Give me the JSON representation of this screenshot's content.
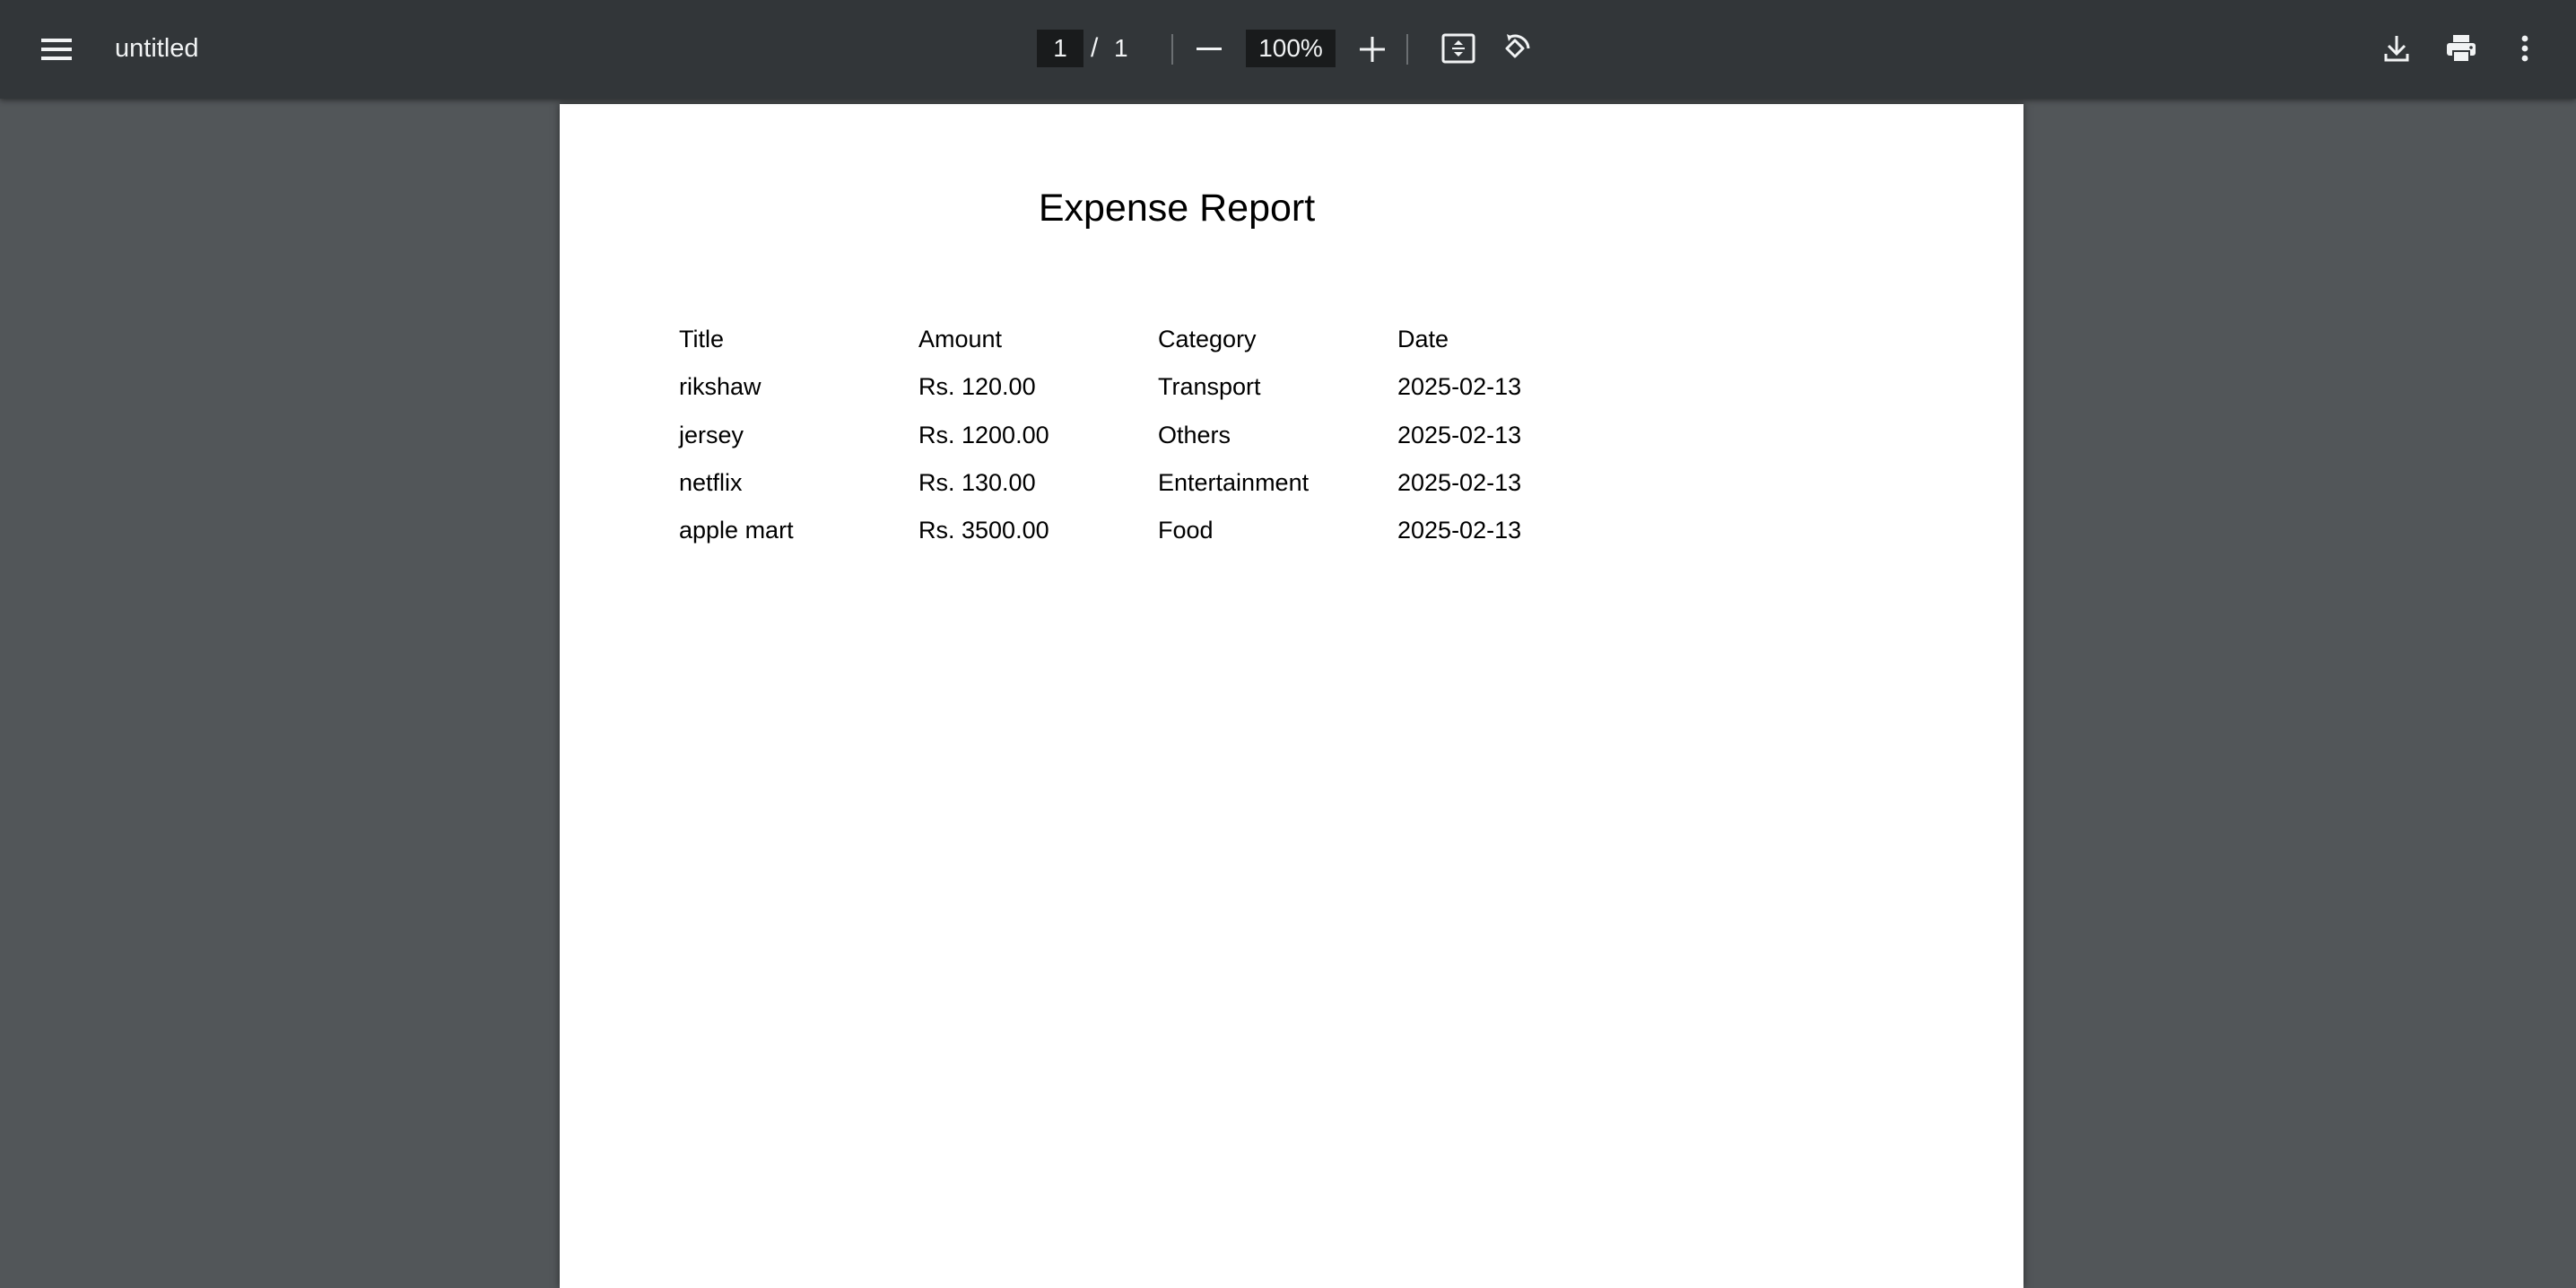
{
  "toolbar": {
    "menu_icon": "hamburger-menu-icon",
    "title": "untitled",
    "page_current": "1",
    "page_separator": "/",
    "page_total": "1",
    "zoom_value": "100%",
    "icons": {
      "zoom_out": "minus-icon",
      "zoom_in": "plus-icon",
      "fit_page": "fit-to-page-icon",
      "rotate": "rotate-counterclockwise-icon",
      "download": "download-icon",
      "print": "print-icon",
      "more": "more-vert-icon"
    }
  },
  "document": {
    "title": "Expense Report",
    "headers": [
      "Title",
      "Amount",
      "Category",
      "Date"
    ],
    "rows": [
      [
        "rikshaw",
        "Rs. 120.00",
        "Transport",
        "2025-02-13"
      ],
      [
        "jersey",
        "Rs. 1200.00",
        "Others",
        "2025-02-13"
      ],
      [
        "netflix",
        "Rs. 130.00",
        "Entertainment",
        "2025-02-13"
      ],
      [
        "apple mart",
        "Rs. 3500.00",
        "Food",
        "2025-02-13"
      ]
    ]
  },
  "colors": {
    "toolbar_bg": "#323639",
    "viewer_bg": "#525659",
    "input_bg": "#191b1c",
    "toolbar_text": "#f1f3f4"
  }
}
